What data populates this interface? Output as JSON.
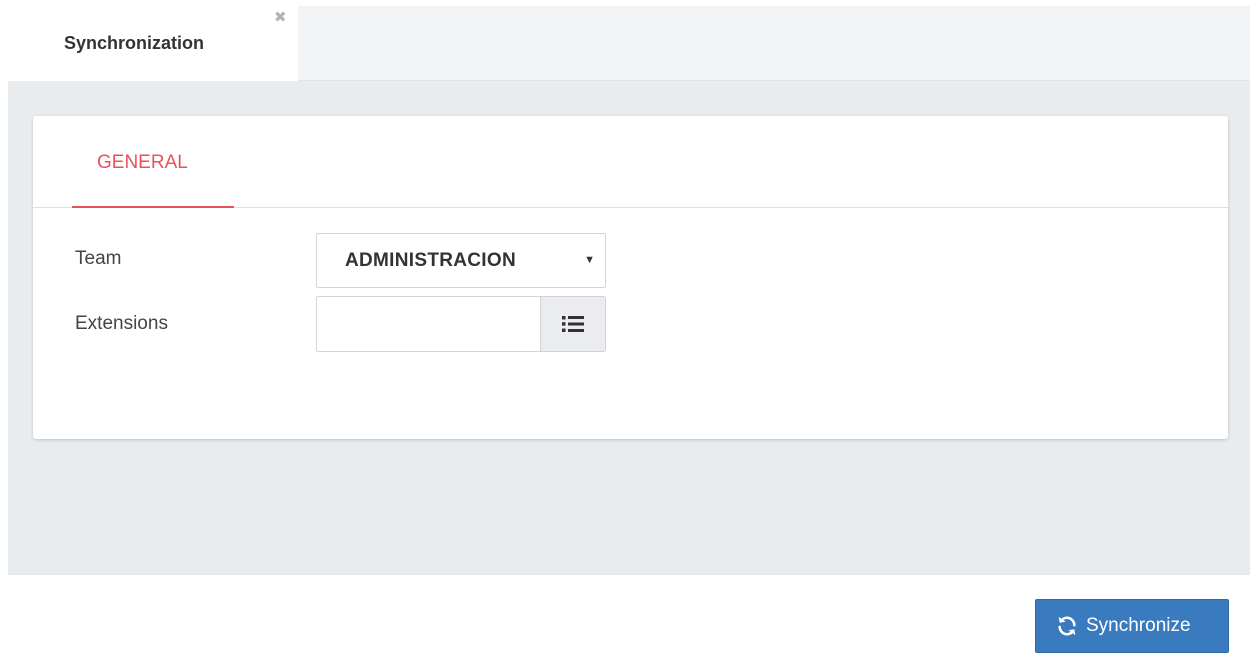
{
  "window": {
    "tab_label": "Synchronization",
    "close_symbol": "✖"
  },
  "panel": {
    "active_tab": "GENERAL"
  },
  "form": {
    "team": {
      "label": "Team",
      "selected_value": "ADMINISTRACION",
      "caret": "▼"
    },
    "extensions": {
      "label": "Extensions",
      "value": "",
      "button_icon": "list-icon"
    }
  },
  "footer": {
    "sync_label": "Synchronize",
    "sync_icon": "refresh-icon"
  },
  "colors": {
    "accent": "#e8515e",
    "primary_button": "#3a7bbf",
    "background": "#e9ecef"
  }
}
